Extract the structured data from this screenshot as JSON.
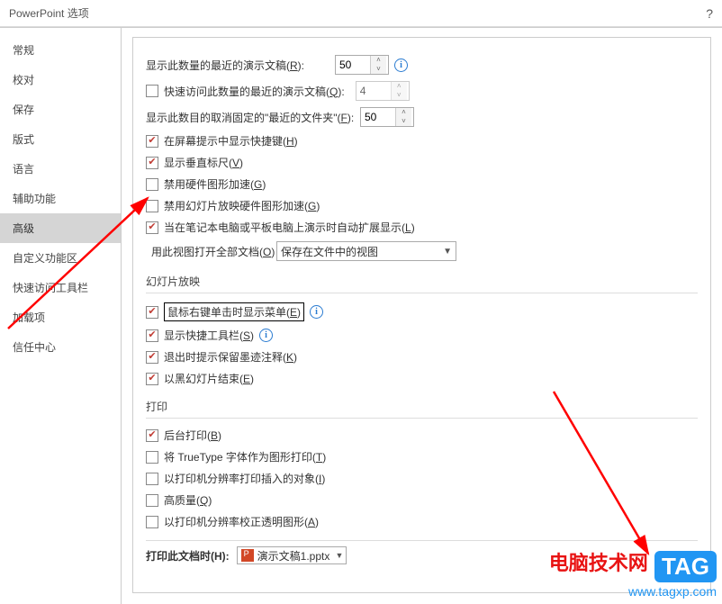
{
  "title": "PowerPoint 选项",
  "help_symbol": "?",
  "sidebar": {
    "items": [
      {
        "label": "常规"
      },
      {
        "label": "校对"
      },
      {
        "label": "保存"
      },
      {
        "label": "版式"
      },
      {
        "label": "语言"
      },
      {
        "label": "辅助功能"
      },
      {
        "label": "高级"
      },
      {
        "label": "自定义功能区"
      },
      {
        "label": "快速访问工具栏"
      },
      {
        "label": "加载项"
      },
      {
        "label": "信任中心"
      }
    ],
    "active_index": 6
  },
  "display": {
    "recent_count_label": "显示此数量的最近的演示文稿(",
    "recent_count_key": "R",
    "recent_count_label2": "):",
    "recent_count_value": "50",
    "quick_access_label": "快速访问此数量的最近的演示文稿(",
    "quick_access_key": "Q",
    "quick_access_label2": "):",
    "quick_access_value": "4",
    "unpinned_label": "显示此数目的取消固定的\"最近的文件夹\"(",
    "unpinned_key": "F",
    "unpinned_label2": "):",
    "unpinned_value": "50",
    "screentips_label": "在屏幕提示中显示快捷键(",
    "screentips_key": "H",
    "screentips_label2": ")",
    "vruler_label": "显示垂直标尺(",
    "vruler_key": "V",
    "vruler_label2": ")",
    "hw_accel_label": "禁用硬件图形加速(",
    "hw_accel_key": "G",
    "hw_accel_label2": ")",
    "slideshow_hw_label": "禁用幻灯片放映硬件图形加速(",
    "slideshow_hw_key": "G",
    "slideshow_hw_label2": ")",
    "auto_extend_label": "当在笔记本电脑或平板电脑上演示时自动扩展显示(",
    "auto_extend_key": "L",
    "auto_extend_label2": ")",
    "open_docs_label": "用此视图打开全部文档(",
    "open_docs_key": "O",
    "open_docs_label2": ")",
    "open_docs_value": "保存在文件中的视图"
  },
  "slideshow_section": {
    "header": "幻灯片放映",
    "rightclick_label": "鼠标右键单击时显示菜单(",
    "rightclick_key": "E",
    "rightclick_label2": ")",
    "toolbar_label": "显示快捷工具栏(",
    "toolbar_key": "S",
    "toolbar_label2": ")",
    "ink_label": "退出时提示保留墨迹注释(",
    "ink_key": "K",
    "ink_label2": ")",
    "endblack_label": "以黑幻灯片结束(",
    "endblack_key": "E",
    "endblack_label2": ")"
  },
  "print_section": {
    "header": "打印",
    "background_label": "后台打印(",
    "background_key": "B",
    "background_label2": ")",
    "truetype_label": "将 TrueType 字体作为图形打印(",
    "truetype_key": "T",
    "truetype_label2": ")",
    "resolution_label": "以打印机分辨率打印插入的对象(",
    "resolution_key": "I",
    "resolution_label2": ")",
    "quality_label": "高质量(",
    "quality_key": "Q",
    "quality_label2": ")",
    "transparent_label": "以打印机分辨率校正透明图形(",
    "transparent_key": "A",
    "transparent_label2": ")",
    "print_doc_label": "打印此文档时(H):",
    "print_doc_value": "演示文稿1.pptx"
  },
  "watermark": {
    "brand": "电脑技术网",
    "tag": "TAG",
    "url": "www.tagxp.com"
  }
}
